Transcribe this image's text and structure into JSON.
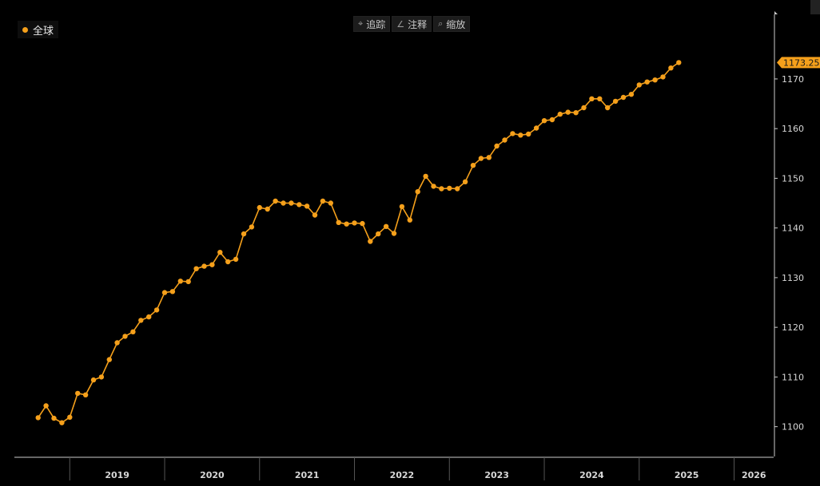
{
  "toolbar": {
    "items": [
      {
        "icon": "crosshair-icon",
        "glyph": "⌖",
        "label": "追踪"
      },
      {
        "icon": "pencil-icon",
        "glyph": "∠",
        "label": "注释"
      },
      {
        "icon": "magnifier-icon",
        "glyph": "⌕",
        "label": "缩放"
      }
    ]
  },
  "legend": {
    "label": "全球",
    "color": "#f5a01b"
  },
  "colors": {
    "background": "#000000",
    "series": "#f5a01b",
    "axis": "#cccccc",
    "label_bg": "#f5a01b"
  },
  "chart_data": {
    "type": "line",
    "title": "",
    "xlabel": "",
    "ylabel": "",
    "x_ticks": [
      "2019",
      "2020",
      "2021",
      "2022",
      "2023",
      "2024",
      "2025",
      "2026"
    ],
    "xlim": [
      "2018-06-01",
      "2026-06-01"
    ],
    "ylim": [
      1094,
      1183
    ],
    "y_ticks": [
      1100,
      1110,
      1120,
      1130,
      1140,
      1150,
      1160,
      1170
    ],
    "last_value_label": "1173.2566",
    "grid": false,
    "legend_position": "top-left",
    "series": [
      {
        "name": "全球",
        "color": "#f5a01b",
        "points": [
          [
            "2018-09",
            1101.8
          ],
          [
            "2018-10",
            1104.2
          ],
          [
            "2018-11",
            1101.7
          ],
          [
            "2018-12",
            1100.8
          ],
          [
            "2019-01",
            1101.9
          ],
          [
            "2019-02",
            1106.7
          ],
          [
            "2019-03",
            1106.4
          ],
          [
            "2019-04",
            1109.4
          ],
          [
            "2019-05",
            1110.0
          ],
          [
            "2019-06",
            1113.5
          ],
          [
            "2019-07",
            1116.9
          ],
          [
            "2019-08",
            1118.2
          ],
          [
            "2019-09",
            1119.1
          ],
          [
            "2019-10",
            1121.4
          ],
          [
            "2019-11",
            1122.1
          ],
          [
            "2019-12",
            1123.5
          ],
          [
            "2020-01",
            1127.0
          ],
          [
            "2020-02",
            1127.2
          ],
          [
            "2020-03",
            1129.3
          ],
          [
            "2020-04",
            1129.2
          ],
          [
            "2020-05",
            1131.8
          ],
          [
            "2020-06",
            1132.3
          ],
          [
            "2020-07",
            1132.6
          ],
          [
            "2020-08",
            1135.1
          ],
          [
            "2020-09",
            1133.2
          ],
          [
            "2020-10",
            1133.7
          ],
          [
            "2020-11",
            1138.8
          ],
          [
            "2020-12",
            1140.2
          ],
          [
            "2021-01",
            1144.1
          ],
          [
            "2021-02",
            1143.8
          ],
          [
            "2021-03",
            1145.4
          ],
          [
            "2021-04",
            1145.0
          ],
          [
            "2021-05",
            1145.0
          ],
          [
            "2021-06",
            1144.7
          ],
          [
            "2021-07",
            1144.4
          ],
          [
            "2021-08",
            1142.6
          ],
          [
            "2021-09",
            1145.4
          ],
          [
            "2021-10",
            1145.0
          ],
          [
            "2021-11",
            1141.1
          ],
          [
            "2021-12",
            1140.8
          ],
          [
            "2022-01",
            1141.0
          ],
          [
            "2022-02",
            1140.9
          ],
          [
            "2022-03",
            1137.3
          ],
          [
            "2022-04",
            1138.8
          ],
          [
            "2022-05",
            1140.3
          ],
          [
            "2022-06",
            1138.9
          ],
          [
            "2022-07",
            1144.3
          ],
          [
            "2022-08",
            1141.6
          ],
          [
            "2022-09",
            1147.3
          ],
          [
            "2022-10",
            1150.4
          ],
          [
            "2022-11",
            1148.4
          ],
          [
            "2022-12",
            1147.9
          ],
          [
            "2023-01",
            1148.0
          ],
          [
            "2023-02",
            1147.9
          ],
          [
            "2023-03",
            1149.3
          ],
          [
            "2023-04",
            1152.6
          ],
          [
            "2023-05",
            1154.0
          ],
          [
            "2023-06",
            1154.2
          ],
          [
            "2023-07",
            1156.5
          ],
          [
            "2023-08",
            1157.7
          ],
          [
            "2023-09",
            1159.0
          ],
          [
            "2023-10",
            1158.7
          ],
          [
            "2023-11",
            1158.9
          ],
          [
            "2023-12",
            1160.1
          ],
          [
            "2024-01",
            1161.6
          ],
          [
            "2024-02",
            1161.8
          ],
          [
            "2024-03",
            1162.9
          ],
          [
            "2024-04",
            1163.3
          ],
          [
            "2024-05",
            1163.2
          ],
          [
            "2024-06",
            1164.2
          ],
          [
            "2024-07",
            1166.0
          ],
          [
            "2024-08",
            1166.0
          ],
          [
            "2024-09",
            1164.2
          ],
          [
            "2024-10",
            1165.5
          ],
          [
            "2024-11",
            1166.3
          ],
          [
            "2024-12",
            1166.9
          ],
          [
            "2025-01",
            1168.8
          ],
          [
            "2025-02",
            1169.4
          ],
          [
            "2025-03",
            1169.8
          ],
          [
            "2025-04",
            1170.4
          ],
          [
            "2025-05",
            1172.2
          ],
          [
            "2025-06",
            1173.3
          ]
        ]
      }
    ]
  }
}
